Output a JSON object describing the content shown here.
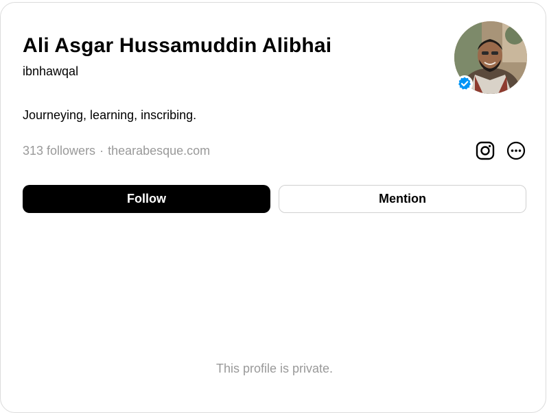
{
  "profile": {
    "full_name": "Ali Asgar Hussamuddin Alibhai",
    "username": "ibnhawqal",
    "bio": "Journeying, learning, inscribing.",
    "followers": "313 followers",
    "separator": "·",
    "website": "thearabesque.com",
    "verified": true,
    "verified_color": "#0095f6"
  },
  "icons": {
    "instagram": "instagram-icon",
    "more": "more-options-icon"
  },
  "actions": {
    "follow_label": "Follow",
    "mention_label": "Mention"
  },
  "notice": {
    "private_text": "This profile is private."
  }
}
